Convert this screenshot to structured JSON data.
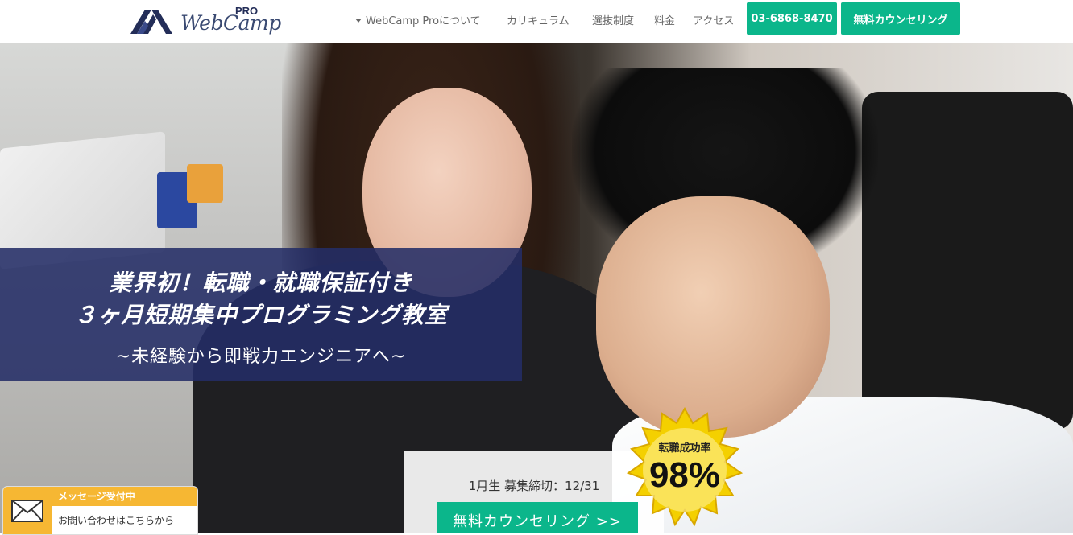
{
  "header": {
    "logo_text": "WebCamp",
    "logo_sup": "PRO",
    "nav": [
      {
        "label": "WebCamp Proについて",
        "has_caret": true
      },
      {
        "label": "カリキュラム"
      },
      {
        "label": "選抜制度"
      },
      {
        "label": "料金"
      },
      {
        "label": "アクセス"
      }
    ],
    "phone_button": "03-6868-8470",
    "counseling_button": "無料カウンセリング"
  },
  "hero": {
    "headline_line1": "業界初！転職・就職保証付き",
    "headline_line2": "３ヶ月短期集中プログラミング教室",
    "subline": "~未経験から即戦力エンジニアへ~",
    "deadline": "1月生 募集締切：12/31",
    "cta_button": "無料カウンセリング >>",
    "badge_title": "転職成功率",
    "badge_value": "98%"
  },
  "chat": {
    "status": "メッセージ受付中",
    "subtext": "お問い合わせはこちらから"
  },
  "colors": {
    "accent_green": "#0bb68b",
    "navy": "#242d66",
    "badge_yellow": "#f4d000"
  }
}
